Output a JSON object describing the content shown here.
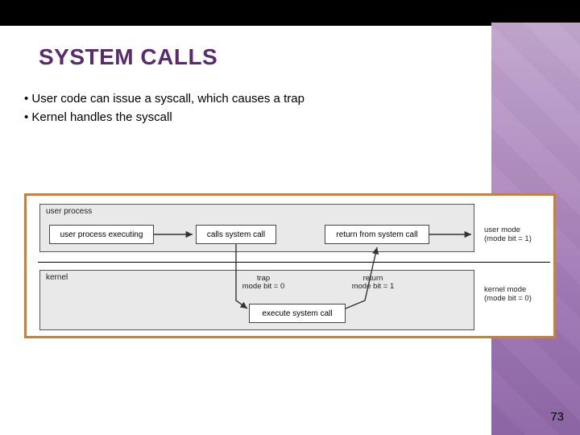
{
  "slide": {
    "title": "SYSTEM CALLS",
    "bullets": [
      "User code can issue a syscall, which causes a trap",
      "Kernel handles the syscall"
    ],
    "page_number": "73"
  },
  "diagram": {
    "user_region_label": "user process",
    "kernel_region_label": "kernel",
    "user_box_exec": "user process executing",
    "user_box_call": "calls system call",
    "user_box_return": "return from system call",
    "kernel_box_exec": "execute system call",
    "trap_label_1": "trap",
    "trap_label_2": "mode bit = 0",
    "return_label_1": "return",
    "return_label_2": "mode bit = 1",
    "mode_user_1": "user mode",
    "mode_user_2": "(mode bit = 1)",
    "mode_kernel_1": "kernel mode",
    "mode_kernel_2": "(mode bit = 0)"
  }
}
